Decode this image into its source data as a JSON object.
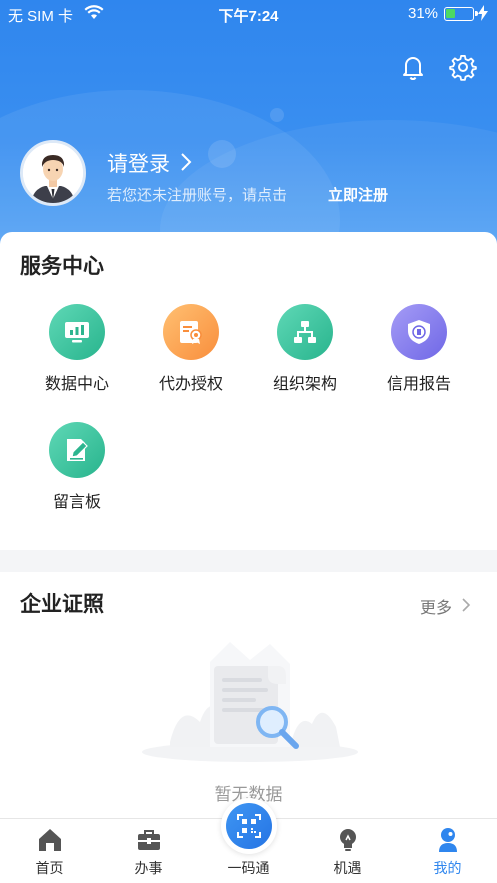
{
  "status_bar": {
    "carrier": "无 SIM 卡",
    "time": "下午7:24",
    "battery_pct": "31%",
    "battery_level": 0.31
  },
  "header": {
    "icons": [
      "bell-icon",
      "gear-icon"
    ],
    "login_title": "请登录",
    "login_subtitle": "若您还未注册账号，请点击",
    "register_link": "立即注册"
  },
  "service_center": {
    "title": "服务中心",
    "items": [
      {
        "label": "数据中心",
        "icon": "data-chart-icon",
        "color": "#2db58f"
      },
      {
        "label": "代办授权",
        "icon": "authorization-icon",
        "color": "#f98e3c"
      },
      {
        "label": "组织架构",
        "icon": "org-chart-icon",
        "color": "#2db58f"
      },
      {
        "label": "信用报告",
        "icon": "credit-shield-icon",
        "color": "#6f67e6"
      },
      {
        "label": "留言板",
        "icon": "message-edit-icon",
        "color": "#2db58f"
      }
    ]
  },
  "enterprise_certificates": {
    "title": "企业证照",
    "more_label": "更多",
    "empty_text": "暂无数据"
  },
  "tab_bar": {
    "items": [
      {
        "label": "首页",
        "icon": "home-icon",
        "active": false
      },
      {
        "label": "办事",
        "icon": "briefcase-icon",
        "active": false
      },
      {
        "label": "一码通",
        "icon": "qr-code-icon",
        "active": false
      },
      {
        "label": "机遇",
        "icon": "lightbulb-icon",
        "active": false
      },
      {
        "label": "我的",
        "icon": "user-icon",
        "active": true
      }
    ]
  },
  "colors": {
    "brand_blue": "#2f86ee",
    "active_tab": "#2f86ee"
  }
}
